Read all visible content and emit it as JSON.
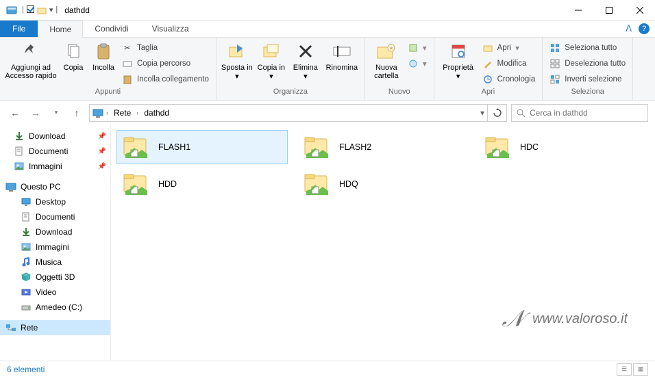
{
  "window": {
    "title": "dathdd"
  },
  "tabs": {
    "file": "File",
    "home": "Home",
    "share": "Condividi",
    "view": "Visualizza"
  },
  "ribbon": {
    "clipboard": {
      "label": "Appunti",
      "pin": "Aggiungi ad Accesso rapido",
      "copy": "Copia",
      "paste": "Incolla",
      "cut": "Taglia",
      "copypath": "Copia percorso",
      "pastelink": "Incolla collegamento"
    },
    "organize": {
      "label": "Organizza",
      "moveto": "Sposta in",
      "copyto": "Copia in",
      "delete": "Elimina",
      "rename": "Rinomina"
    },
    "new": {
      "label": "Nuovo",
      "newfolder": "Nuova cartella"
    },
    "open": {
      "label": "Apri",
      "properties": "Proprietà",
      "open": "Apri",
      "edit": "Modifica",
      "history": "Cronologia"
    },
    "select": {
      "label": "Seleziona",
      "all": "Seleziona tutto",
      "none": "Deseleziona tutto",
      "invert": "Inverti selezione"
    }
  },
  "breadcrumb": {
    "root": "Rete",
    "current": "dathdd"
  },
  "search": {
    "placeholder": "Cerca in dathdd"
  },
  "sidebar": {
    "quick": [
      {
        "label": "Download",
        "icon": "download"
      },
      {
        "label": "Documenti",
        "icon": "documents"
      },
      {
        "label": "Immagini",
        "icon": "pictures"
      }
    ],
    "thispc_label": "Questo PC",
    "thispc": [
      {
        "label": "Desktop",
        "icon": "desktop"
      },
      {
        "label": "Documenti",
        "icon": "documents"
      },
      {
        "label": "Download",
        "icon": "download"
      },
      {
        "label": "Immagini",
        "icon": "pictures"
      },
      {
        "label": "Musica",
        "icon": "music"
      },
      {
        "label": "Oggetti 3D",
        "icon": "objects3d"
      },
      {
        "label": "Video",
        "icon": "video"
      },
      {
        "label": "Amedeo (C:)",
        "icon": "drive"
      }
    ],
    "network_label": "Rete"
  },
  "folders": [
    {
      "name": "FLASH1",
      "selected": true
    },
    {
      "name": "FLASH2",
      "selected": false
    },
    {
      "name": "HDC",
      "selected": false
    },
    {
      "name": "HDD",
      "selected": false
    },
    {
      "name": "HDQ",
      "selected": false
    }
  ],
  "status": {
    "count": "6 elementi"
  },
  "watermark": "www.valoroso.it"
}
